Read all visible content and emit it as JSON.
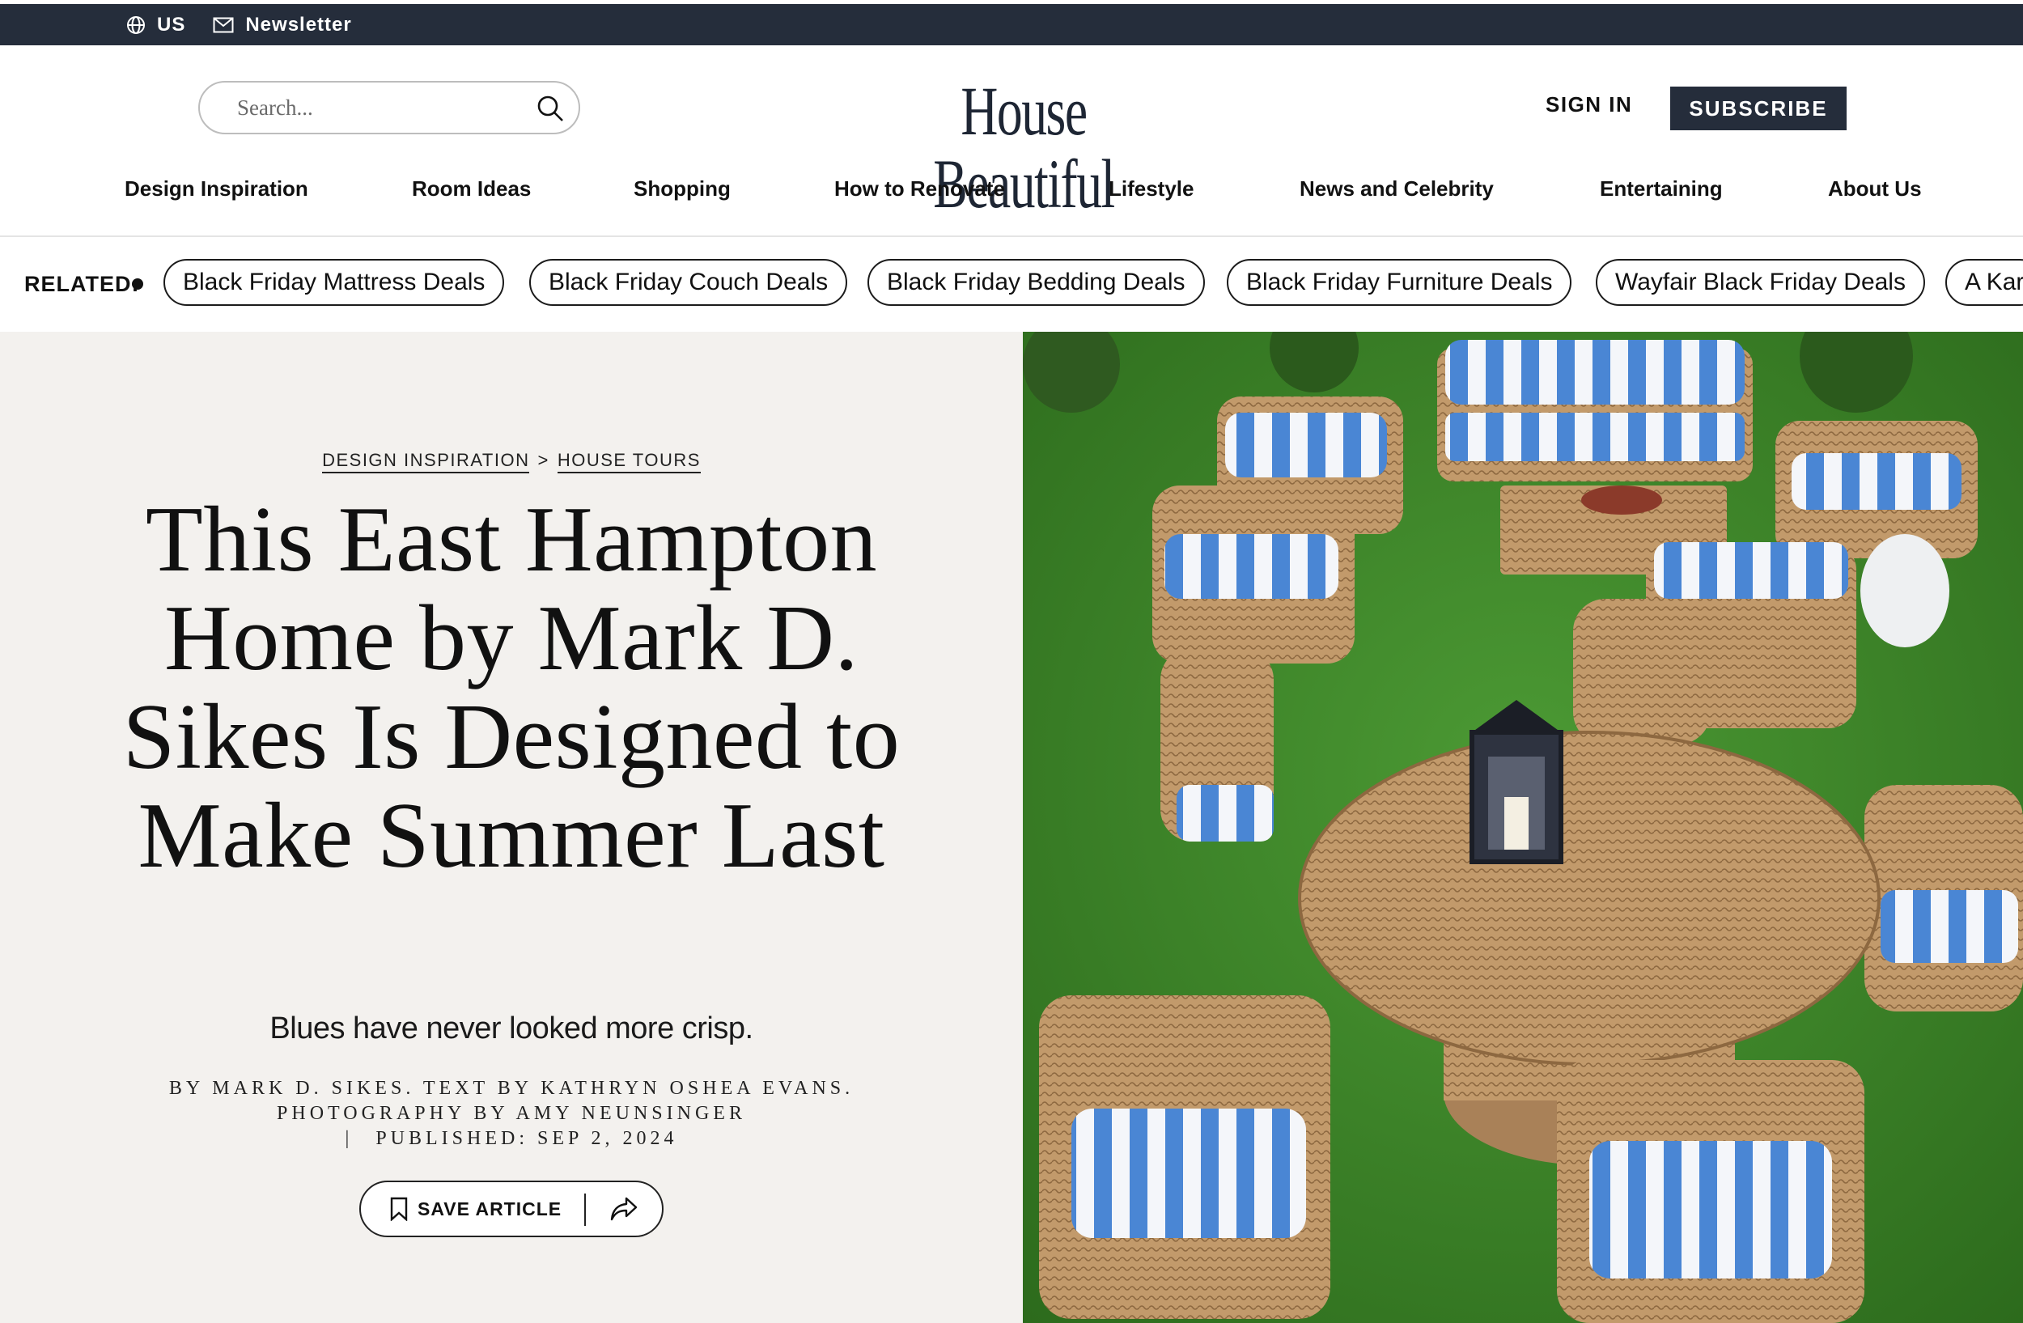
{
  "topbar": {
    "region": "US",
    "newsletter": "Newsletter",
    "icons": [
      "globe-icon",
      "mail-icon"
    ]
  },
  "header": {
    "search_placeholder": "Search...",
    "logo": "House Beautiful",
    "sign_in": "SIGN IN",
    "subscribe": "SUBSCRIBE",
    "icons": [
      "search-icon"
    ]
  },
  "nav": {
    "items": [
      "Design Inspiration",
      "Room Ideas",
      "Shopping",
      "How to Renovate",
      "Lifestyle",
      "News and Celebrity",
      "Entertaining",
      "About Us"
    ]
  },
  "related": {
    "label": "RELATED:",
    "pills": [
      "Black Friday Mattress Deals",
      "Black Friday Couch Deals",
      "Black Friday Bedding Deals",
      "Black Friday Furniture Deals",
      "Wayfair Black Friday Deals",
      "A Kar"
    ]
  },
  "article": {
    "breadcrumb": [
      "DESIGN INSPIRATION",
      ">",
      "HOUSE TOURS"
    ],
    "title": "This East Hampton Home by Mark D. Sikes Is Designed to Make Summer Last",
    "dek": "Blues have never looked more crisp.",
    "byline_1": "BY MARK D. SIKES. TEXT BY KATHRYN OSHEA EVANS.",
    "byline_2": "PHOTOGRAPHY BY AMY NEUNSINGER",
    "byline_sep": "|",
    "byline_3": "PUBLISHED: SEP 2, 2024",
    "save_label": "SAVE ARTICLE",
    "icons": [
      "bookmark-icon",
      "share-icon"
    ]
  },
  "colors": {
    "topbar_bg": "#252d3b",
    "subscribe_bg": "#252d3b",
    "hero_left_bg": "#f3f1ee",
    "grass": "#3f8a2a",
    "cushion_blue": "#3d7ccf",
    "wicker": "#b48a5e"
  }
}
